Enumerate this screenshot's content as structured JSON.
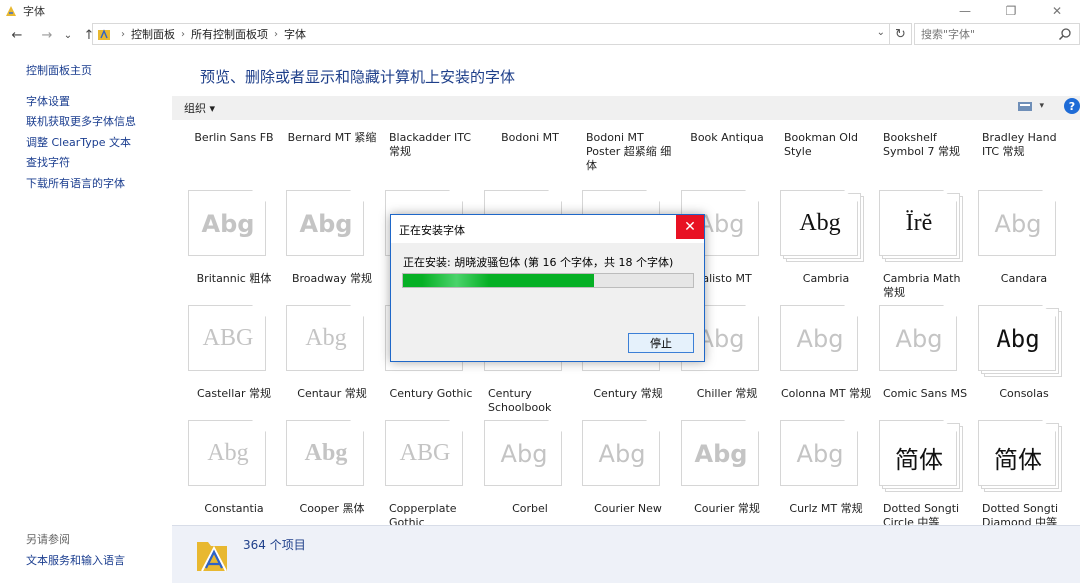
{
  "window": {
    "title": "字体",
    "minimize": "—",
    "restore": "❐",
    "close": "✕"
  },
  "address": {
    "back": "←",
    "forward": "→",
    "history": "⌄",
    "up": "↑",
    "breadcrumb": [
      "控制面板",
      "所有控制面板项",
      "字体"
    ],
    "refresh": "↻",
    "search_placeholder": "搜索\"字体\""
  },
  "sidebar": {
    "home": "控制面板主页",
    "links": [
      "字体设置",
      "联机获取更多字体信息",
      "调整 ClearType 文本",
      "查找字符",
      "下载所有语言的字体"
    ],
    "see_also": "另请参阅",
    "see_also_link": "文本服务和输入语言"
  },
  "main": {
    "title": "预览、删除或者显示和隐藏计算机上安装的字体",
    "organize": "组织 ▾",
    "view_drop": "▾",
    "help": "?",
    "status_text": "364 个项目"
  },
  "fonts": {
    "row0": [
      {
        "label": "Berlin Sans FB"
      },
      {
        "label": "Bernard MT 紧缩"
      },
      {
        "label": "Blackadder ITC 常规"
      },
      {
        "label": "Bodoni MT"
      },
      {
        "label": "Bodoni MT Poster 超紧缩 细体"
      },
      {
        "label": "Book Antiqua"
      },
      {
        "label": "Bookman Old Style"
      },
      {
        "label": "Bookshelf Symbol 7 常规"
      },
      {
        "label": "Bradley Hand ITC 常规"
      }
    ],
    "row1": [
      {
        "label": "Britannic 粗体",
        "sample": "Abg"
      },
      {
        "label": "Broadway 常规",
        "sample": "Abg"
      },
      {
        "label": "",
        "sample": ""
      },
      {
        "label": "",
        "sample": ""
      },
      {
        "label": "",
        "sample": ""
      },
      {
        "label": "alisto MT",
        "sample": "Abg"
      },
      {
        "label": "Cambria",
        "sample": "Abg"
      },
      {
        "label": "Cambria Math 常规",
        "sample": "Ïrĕ"
      },
      {
        "label": "Candara",
        "sample": "Abg"
      }
    ],
    "row2": [
      {
        "label": "Castellar 常规",
        "sample": "ABG"
      },
      {
        "label": "Centaur 常规",
        "sample": "Abg"
      },
      {
        "label": "Century Gothic",
        "sample": ""
      },
      {
        "label": "Century Schoolbook",
        "sample": ""
      },
      {
        "label": "Century 常规",
        "sample": ""
      },
      {
        "label": "Chiller 常规",
        "sample": "Abg"
      },
      {
        "label": "Colonna MT 常规",
        "sample": "Abg"
      },
      {
        "label": "Comic Sans MS",
        "sample": "Abg"
      },
      {
        "label": "Consolas",
        "sample": "Abg"
      }
    ],
    "row3": [
      {
        "label": "Constantia",
        "sample": "Abg"
      },
      {
        "label": "Cooper 黑体",
        "sample": "Abg"
      },
      {
        "label": "Copperplate Gothic",
        "sample": "ABG"
      },
      {
        "label": "Corbel",
        "sample": "Abg"
      },
      {
        "label": "Courier New",
        "sample": "Abg"
      },
      {
        "label": "Courier 常规",
        "sample": "Abg"
      },
      {
        "label": "Curlz MT 常规",
        "sample": "Abg"
      },
      {
        "label": "Dotted Songti Circle 中等",
        "sample": "简体"
      },
      {
        "label": "Dotted Songti Diamond 中等",
        "sample": "简体"
      }
    ]
  },
  "dialog": {
    "title": "正在安装字体",
    "close": "✕",
    "status": "正在安装: 胡晓波骚包体 (第 16 个字体，共 18 个字体)",
    "progress_fraction": 0.66,
    "stop": "停止"
  },
  "colors": {
    "link": "#1a3d8f",
    "title": "#1e3f8a",
    "progress": "#06b025",
    "close_red": "#e81123"
  }
}
